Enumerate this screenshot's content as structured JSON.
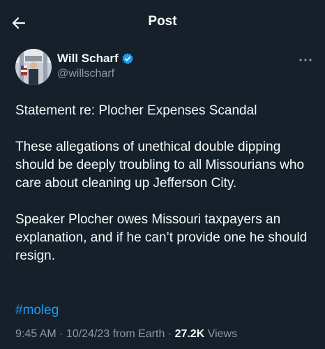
{
  "header": {
    "title": "Post",
    "back_icon": "arrow-left-icon"
  },
  "author": {
    "display_name": "Will Scharf",
    "handle": "@willscharf",
    "verified_icon": "verified-badge-icon",
    "verified_color": "#1d9bf0"
  },
  "tweet": {
    "title_line": "Statement re: Plocher Expenses Scandal",
    "paragraph_1": "These allegations of unethical double dipping should be deeply troubling to all Missourians who care about cleaning up Jefferson City.",
    "paragraph_2": "Speaker Plocher owes Missouri taxpayers an explanation, and if he can’t provide one he should resign.",
    "hashtag": "#moleg"
  },
  "meta": {
    "time": "9:45 AM",
    "sep1": " · ",
    "date": "10/24/23",
    "source": " from Earth",
    "sep2": " · ",
    "views_count": "27.2K",
    "views_label": " Views"
  },
  "colors": {
    "background": "#15202b",
    "text": "#f7f9f9",
    "secondary_text": "#8b98a5",
    "link": "#1d9bf0"
  }
}
